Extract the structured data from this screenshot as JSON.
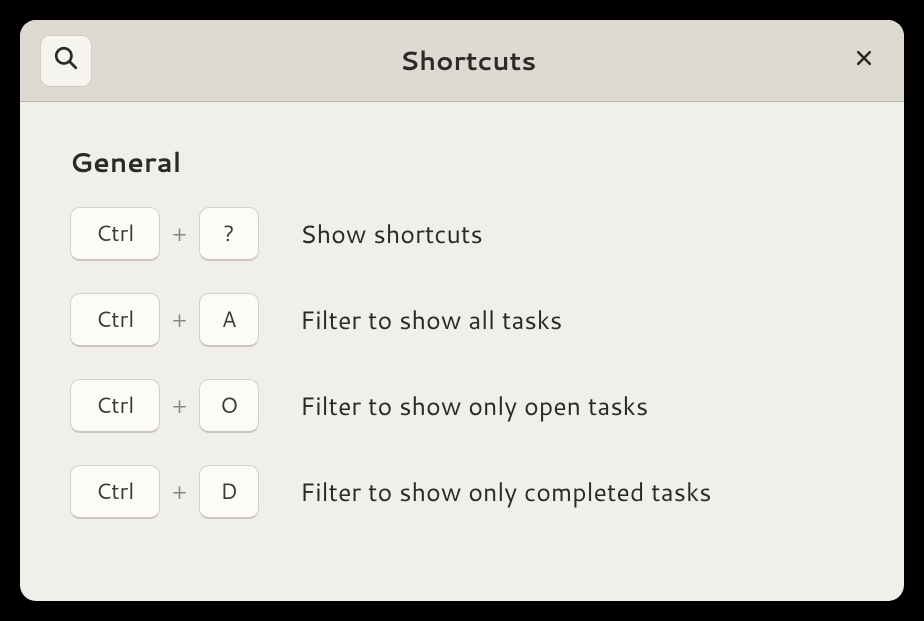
{
  "header": {
    "title": "Shortcuts"
  },
  "section": {
    "title": "General"
  },
  "shortcuts": [
    {
      "key1": "Ctrl",
      "separator": "+",
      "key2": "?",
      "description": "Show shortcuts"
    },
    {
      "key1": "Ctrl",
      "separator": "+",
      "key2": "A",
      "description": "Filter to show all tasks"
    },
    {
      "key1": "Ctrl",
      "separator": "+",
      "key2": "O",
      "description": "Filter to show only open tasks"
    },
    {
      "key1": "Ctrl",
      "separator": "+",
      "key2": "D",
      "description": "Filter to show only completed tasks"
    }
  ]
}
